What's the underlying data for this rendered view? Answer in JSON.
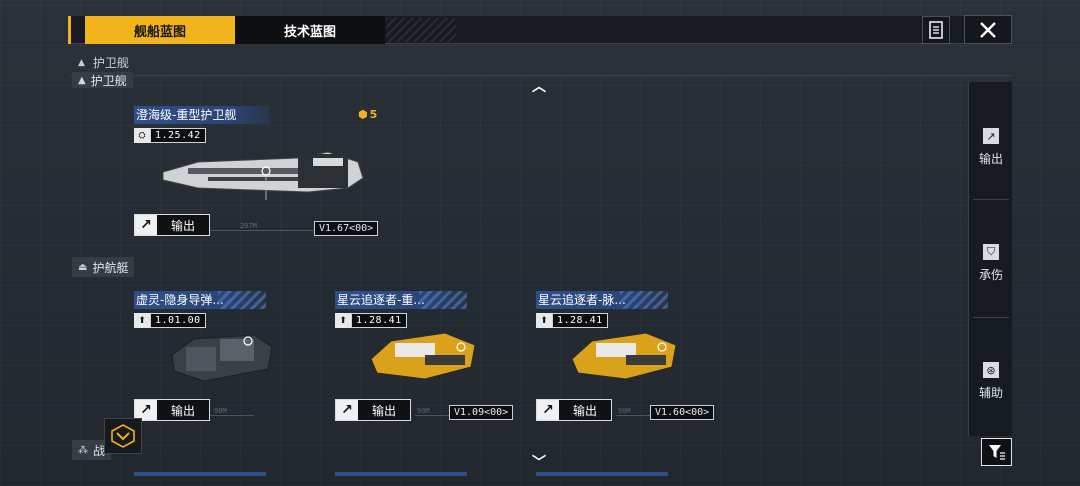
{
  "tabs": {
    "ship_blueprint": "舰船蓝图",
    "tech_blueprint": "技术蓝图"
  },
  "icons": {
    "doc": "document-icon",
    "close": "close-icon",
    "filter": "filter-icon"
  },
  "section": {
    "title": "护卫舰"
  },
  "groups": {
    "frigate": "护卫舰",
    "corvette": "护航艇",
    "destroyer": "战"
  },
  "cards": [
    {
      "name": "澄海级-重型护卫舰",
      "rank": "1.25.42",
      "count": "5",
      "export_label": "输出",
      "version": "V1.67<00>",
      "scale": "207M"
    },
    {
      "name": "虚灵-隐身导弹...",
      "rank": "1.01.00",
      "export_label": "输出",
      "scale": "90M"
    },
    {
      "name": "星云追逐者-重...",
      "rank": "1.28.41",
      "export_label": "输出",
      "version": "V1.09<00>",
      "scale": "90M"
    },
    {
      "name": "星云追逐者-脉...",
      "rank": "1.28.41",
      "export_label": "输出",
      "version": "V1.60<00>",
      "scale": "90M"
    }
  ],
  "sidebar": {
    "items": [
      {
        "label": "输出",
        "icon": "export-icon"
      },
      {
        "label": "承伤",
        "icon": "shield-icon"
      },
      {
        "label": "辅助",
        "icon": "support-icon"
      }
    ]
  },
  "colors": {
    "accent": "#f3b31a",
    "card_title": "#2f4f8a",
    "background": "#282e35"
  }
}
